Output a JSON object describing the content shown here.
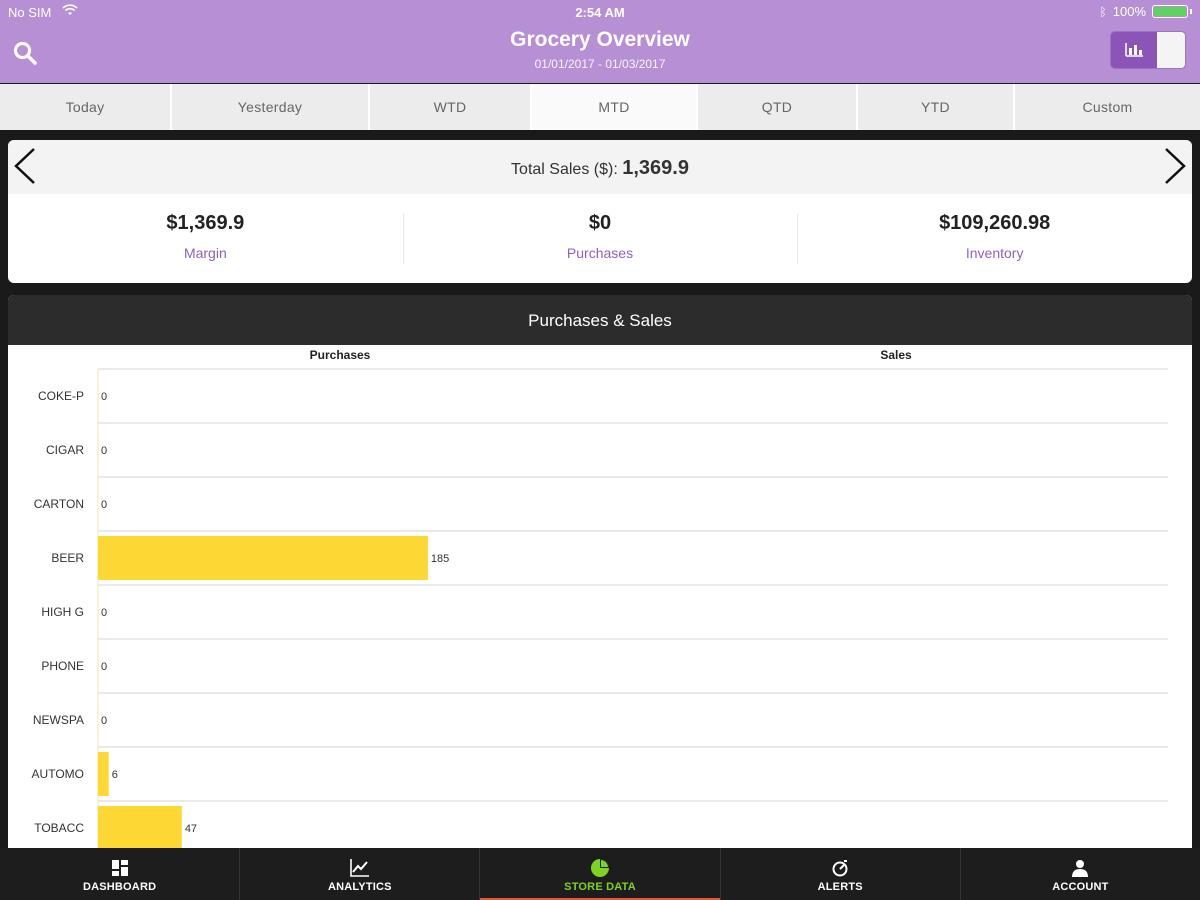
{
  "status": {
    "carrier": "No SIM",
    "time": "2:54 AM",
    "battery": "100%"
  },
  "header": {
    "title": "Grocery Overview",
    "date_range": "01/01/2017 - 01/03/2017"
  },
  "tabs": [
    {
      "label": "Today",
      "active": false
    },
    {
      "label": "Yesterday",
      "active": false
    },
    {
      "label": "WTD",
      "active": false
    },
    {
      "label": "MTD",
      "active": true
    },
    {
      "label": "QTD",
      "active": false
    },
    {
      "label": "YTD",
      "active": false
    },
    {
      "label": "Custom",
      "active": false
    }
  ],
  "summary": {
    "total_label": "Total Sales ($):",
    "total_value": "1,369.9",
    "kpis": [
      {
        "value": "$1,369.9",
        "label": "Margin"
      },
      {
        "value": "$0",
        "label": "Purchases"
      },
      {
        "value": "$109,260.98",
        "label": "Inventory"
      }
    ]
  },
  "chart_card": {
    "title": "Purchases & Sales"
  },
  "chart_data": {
    "type": "bar",
    "orientation": "horizontal",
    "title": "Purchases & Sales",
    "panel_labels": [
      "Purchases",
      "Sales"
    ],
    "categories": [
      "COKE-P",
      "CIGAR",
      "CARTON",
      "BEER",
      "HIGH G",
      "PHONE",
      "NEWSPA",
      "AUTOMO",
      "TOBACC"
    ],
    "series": [
      {
        "name": "Purchases",
        "values": [
          0,
          0,
          0,
          185,
          0,
          0,
          0,
          6,
          47
        ]
      }
    ],
    "xlim": [
      0,
      600
    ],
    "grid": true,
    "colors": {
      "bar": "#fdd835",
      "grid": "#e4e4e4"
    }
  },
  "nav": {
    "items": [
      {
        "label": "DASHBOARD",
        "icon": "dashboard-icon",
        "active": false
      },
      {
        "label": "ANALYTICS",
        "icon": "analytics-icon",
        "active": false
      },
      {
        "label": "STORE DATA",
        "icon": "pie-chart-icon",
        "active": true
      },
      {
        "label": "ALERTS",
        "icon": "alert-icon",
        "active": false
      },
      {
        "label": "ACCOUNT",
        "icon": "account-icon",
        "active": false
      }
    ]
  },
  "colors": {
    "header_bg": "#b68fd5",
    "accent": "#8b55b8",
    "active_nav": "#7ed321"
  }
}
